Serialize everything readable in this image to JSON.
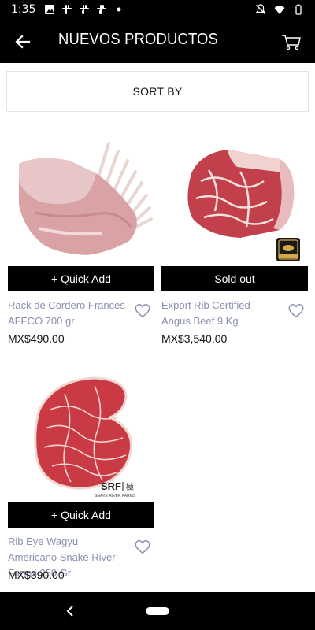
{
  "status": {
    "time": "1:35"
  },
  "header": {
    "title": "NUEVOS PRODUCTOS"
  },
  "sort": {
    "label": "SORT BY"
  },
  "products": [
    {
      "name": "Rack de Cordero Frances AFFCO 700 gr",
      "price": "MX$490.00",
      "button": "+ Quick Add"
    },
    {
      "name": "Export Rib Certified Angus Beef 9 Kg",
      "price": "MX$3,540.00",
      "button": "Sold out"
    },
    {
      "name": "Rib Eye Wagyu Americano Snake River Farms 250 Gr",
      "price": "MX$390.00",
      "button": "+ Quick Add"
    }
  ],
  "badges": {
    "angus": "CERTIFIED ANGUS BEEF",
    "srf": "SRF",
    "srf_sub": "SNAKE RIVER FARMS"
  },
  "colors": {
    "bar": "#000000",
    "name_text": "#8a8fb0",
    "price_text": "#111111"
  },
  "icons": [
    "image-icon",
    "slack-icon",
    "mute-icon",
    "wifi-icon",
    "battery-icon",
    "arrow-back-icon",
    "cart-icon",
    "heart-outline-icon"
  ]
}
